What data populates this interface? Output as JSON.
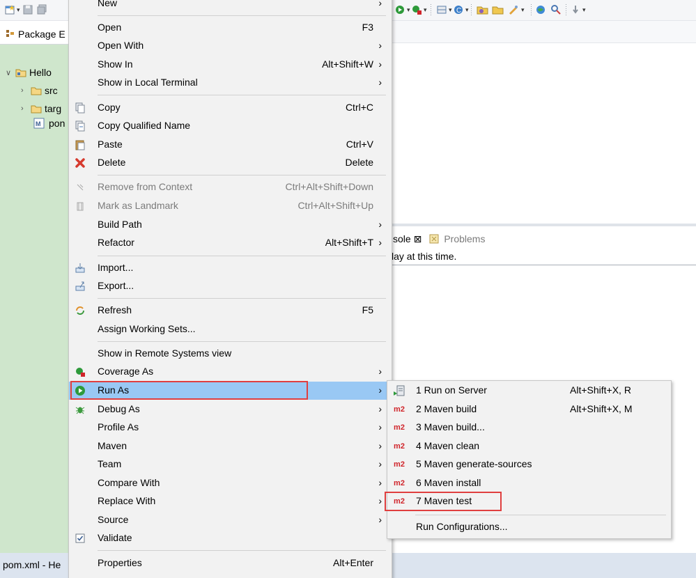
{
  "toolbar": {
    "icons": [
      "new-wizard-icon",
      "save-icon",
      "save-all-icon",
      "run-icon",
      "coverage-icon",
      "new-server-icon",
      "new-class-icon",
      "open-folder-icon",
      "open-type-icon",
      "edit-icon",
      "globe-icon",
      "search-icon",
      "pin-icon"
    ]
  },
  "package_explorer": {
    "tab_label": "Package E",
    "tree": [
      {
        "label": "Hello",
        "icon": "project-icon",
        "expanded": true
      },
      {
        "label": "src",
        "icon": "folder-icon",
        "expanded": false
      },
      {
        "label": "targ",
        "icon": "folder-icon",
        "expanded": false
      },
      {
        "label": "pon",
        "icon": "maven-pom-icon"
      }
    ]
  },
  "console": {
    "tab_console": "sole ⊠",
    "tab_problems": "Problems",
    "message": "lay at this time."
  },
  "status_bar": {
    "text": "pom.xml - He"
  },
  "context_menu": {
    "items": [
      {
        "label": "New",
        "shortcut": "",
        "submenu": true,
        "icon": ""
      },
      {
        "label": "Open",
        "shortcut": "F3",
        "submenu": false,
        "icon": ""
      },
      {
        "label": "Open With",
        "shortcut": "",
        "submenu": true,
        "icon": ""
      },
      {
        "label": "Show In",
        "shortcut": "Alt+Shift+W",
        "submenu": true,
        "icon": ""
      },
      {
        "label": "Show in Local Terminal",
        "shortcut": "",
        "submenu": true,
        "icon": ""
      },
      {
        "label": "Copy",
        "shortcut": "Ctrl+C",
        "submenu": false,
        "icon": "copy-icon"
      },
      {
        "label": "Copy Qualified Name",
        "shortcut": "",
        "submenu": false,
        "icon": "copy-qualified-icon"
      },
      {
        "label": "Paste",
        "shortcut": "Ctrl+V",
        "submenu": false,
        "icon": "paste-icon"
      },
      {
        "label": "Delete",
        "shortcut": "Delete",
        "submenu": false,
        "icon": "delete-icon"
      },
      {
        "label": "Remove from Context",
        "shortcut": "Ctrl+Alt+Shift+Down",
        "submenu": false,
        "icon": "remove-context-icon",
        "disabled": true
      },
      {
        "label": "Mark as Landmark",
        "shortcut": "Ctrl+Alt+Shift+Up",
        "submenu": false,
        "icon": "landmark-icon",
        "disabled": true
      },
      {
        "label": "Build Path",
        "shortcut": "",
        "submenu": true,
        "icon": ""
      },
      {
        "label": "Refactor",
        "shortcut": "Alt+Shift+T",
        "submenu": true,
        "icon": ""
      },
      {
        "label": "Import...",
        "shortcut": "",
        "submenu": false,
        "icon": "import-icon"
      },
      {
        "label": "Export...",
        "shortcut": "",
        "submenu": false,
        "icon": "export-icon"
      },
      {
        "label": "Refresh",
        "shortcut": "F5",
        "submenu": false,
        "icon": "refresh-icon"
      },
      {
        "label": "Assign Working Sets...",
        "shortcut": "",
        "submenu": false,
        "icon": ""
      },
      {
        "label": "Show in Remote Systems view",
        "shortcut": "",
        "submenu": false,
        "icon": ""
      },
      {
        "label": "Coverage As",
        "shortcut": "",
        "submenu": true,
        "icon": "coverage-icon"
      },
      {
        "label": "Run As",
        "shortcut": "",
        "submenu": true,
        "icon": "run-icon",
        "selected": true
      },
      {
        "label": "Debug As",
        "shortcut": "",
        "submenu": true,
        "icon": "debug-icon"
      },
      {
        "label": "Profile As",
        "shortcut": "",
        "submenu": true,
        "icon": ""
      },
      {
        "label": "Maven",
        "shortcut": "",
        "submenu": true,
        "icon": ""
      },
      {
        "label": "Team",
        "shortcut": "",
        "submenu": true,
        "icon": ""
      },
      {
        "label": "Compare With",
        "shortcut": "",
        "submenu": true,
        "icon": ""
      },
      {
        "label": "Replace With",
        "shortcut": "",
        "submenu": true,
        "icon": ""
      },
      {
        "label": "Source",
        "shortcut": "",
        "submenu": true,
        "icon": ""
      },
      {
        "label": "Validate",
        "shortcut": "",
        "submenu": false,
        "icon": "checkbox-icon"
      },
      {
        "label": "Properties",
        "shortcut": "Alt+Enter",
        "submenu": false,
        "icon": ""
      }
    ]
  },
  "run_as_submenu": {
    "items": [
      {
        "label": "1 Run on Server",
        "shortcut": "Alt+Shift+X, R",
        "icon": "server-icon"
      },
      {
        "label": "2 Maven build",
        "shortcut": "Alt+Shift+X, M",
        "icon": "m2"
      },
      {
        "label": "3 Maven build...",
        "shortcut": "",
        "icon": "m2"
      },
      {
        "label": "4 Maven clean",
        "shortcut": "",
        "icon": "m2"
      },
      {
        "label": "5 Maven generate-sources",
        "shortcut": "",
        "icon": "m2"
      },
      {
        "label": "6 Maven install",
        "shortcut": "",
        "icon": "m2"
      },
      {
        "label": "7 Maven test",
        "shortcut": "",
        "icon": "m2",
        "highlighted": true
      },
      {
        "label": "Run Configurations...",
        "shortcut": "",
        "icon": ""
      }
    ]
  },
  "colors": {
    "selection": "#99c8f4",
    "highlight_box": "#e03f3f",
    "maven_icon": "#d0242a",
    "explorer_bg": "#cfe6cc"
  }
}
